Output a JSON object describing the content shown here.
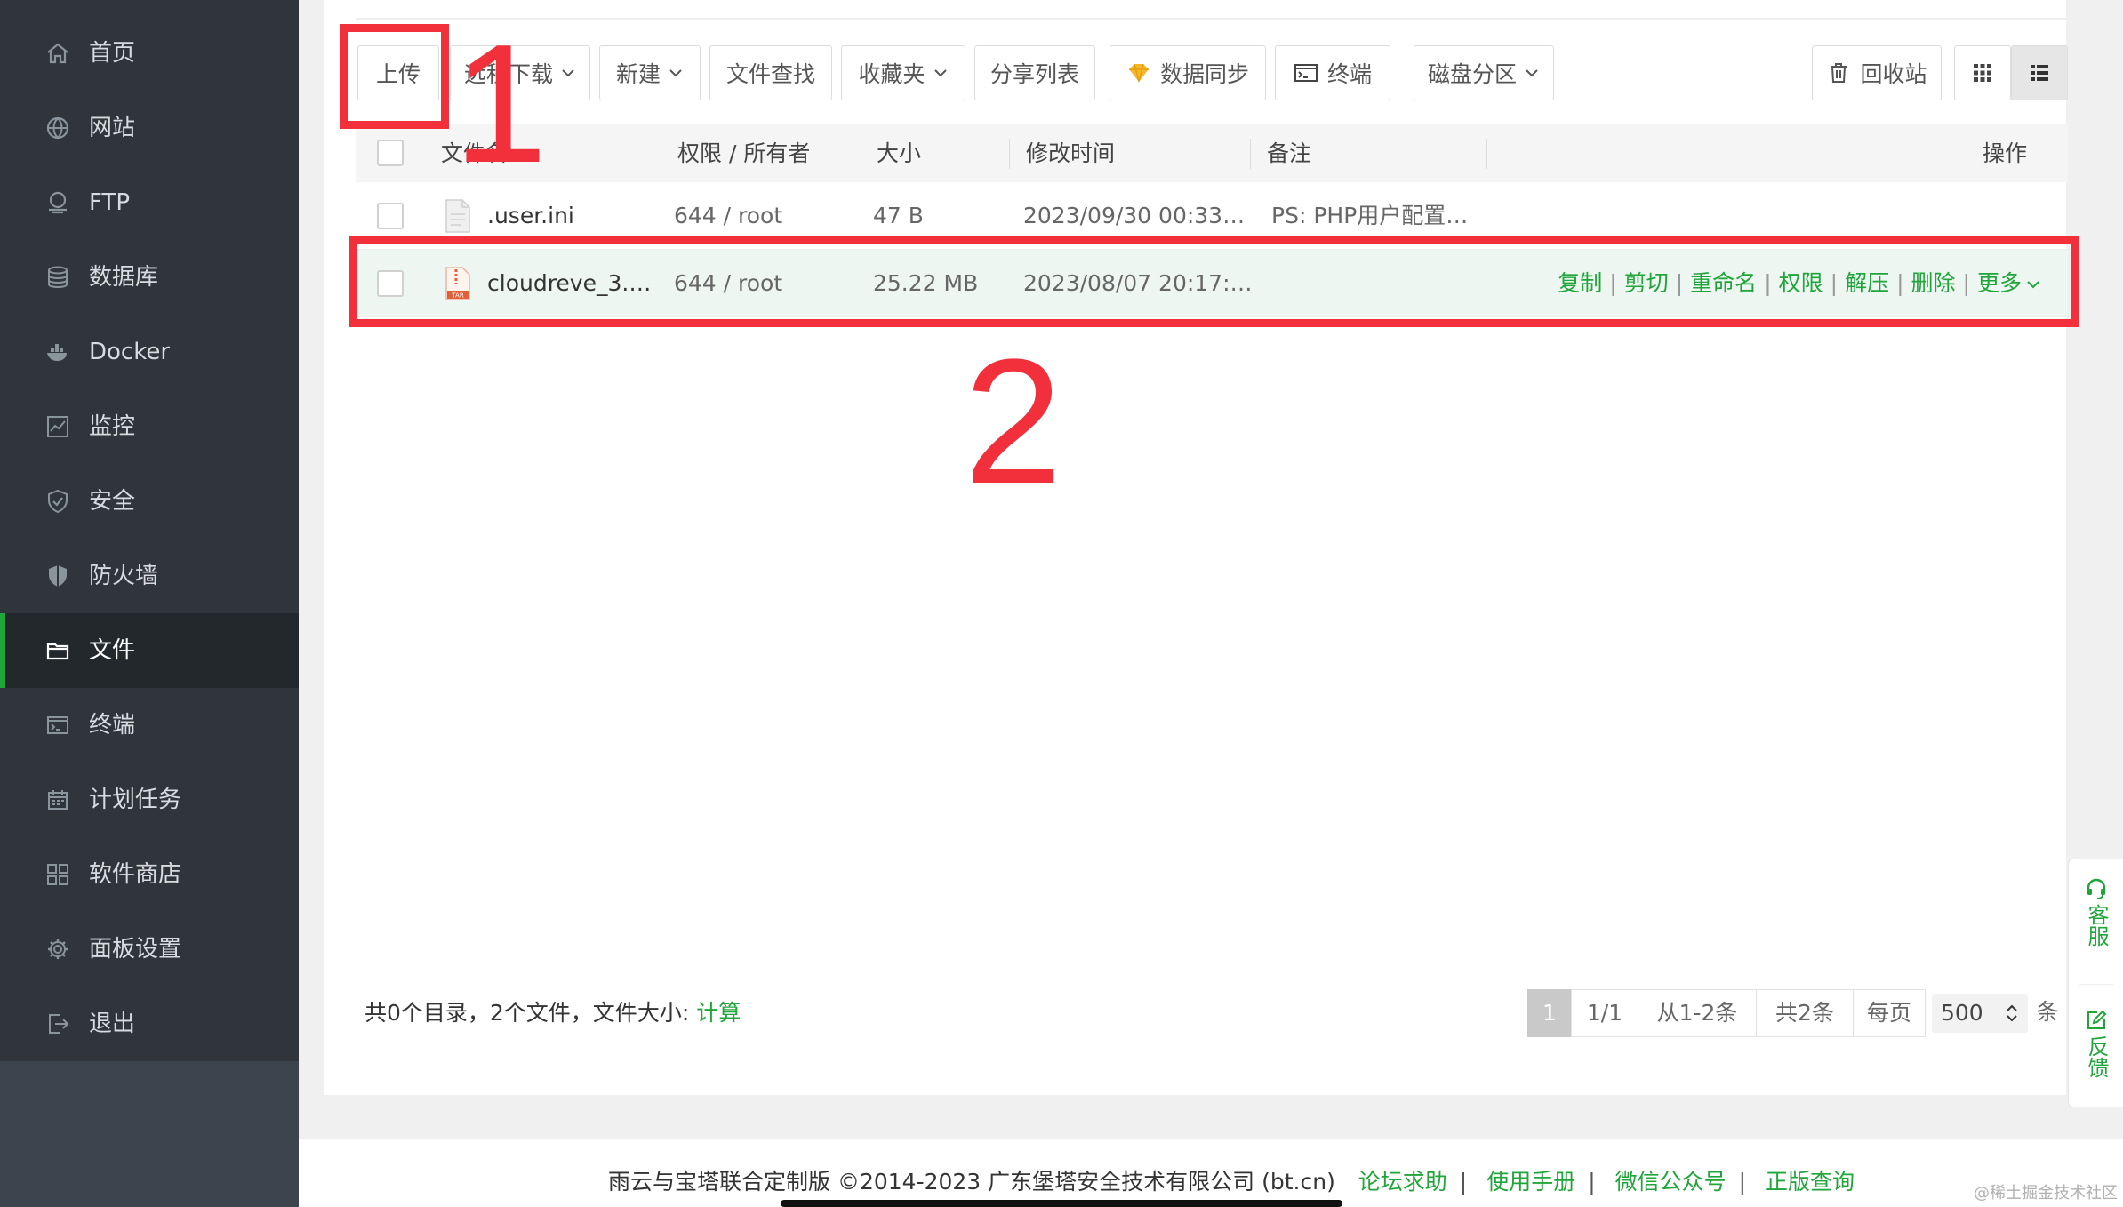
{
  "sidebar": {
    "items": [
      {
        "label": "首页",
        "icon": "home-icon"
      },
      {
        "label": "网站",
        "icon": "globe-icon"
      },
      {
        "label": "FTP",
        "icon": "ftp-icon"
      },
      {
        "label": "数据库",
        "icon": "database-icon"
      },
      {
        "label": "Docker",
        "icon": "docker-icon"
      },
      {
        "label": "监控",
        "icon": "monitor-icon"
      },
      {
        "label": "安全",
        "icon": "shield-check-icon"
      },
      {
        "label": "防火墙",
        "icon": "firewall-icon"
      },
      {
        "label": "文件",
        "icon": "folder-icon",
        "active": true
      },
      {
        "label": "终端",
        "icon": "terminal-icon"
      },
      {
        "label": "计划任务",
        "icon": "calendar-icon"
      },
      {
        "label": "软件商店",
        "icon": "apps-icon"
      },
      {
        "label": "面板设置",
        "icon": "gear-icon"
      },
      {
        "label": "退出",
        "icon": "logout-icon"
      }
    ]
  },
  "toolbar": {
    "upload": "上传",
    "remote_download": "远程下载",
    "new": "新建",
    "file_search": "文件查找",
    "favorites": "收藏夹",
    "share_list": "分享列表",
    "data_sync": "数据同步",
    "terminal": "终端",
    "disk_partition": "磁盘分区",
    "recycle_bin": "回收站"
  },
  "table": {
    "headers": {
      "name": "文件名",
      "perm_owner": "权限 / 所有者",
      "size": "大小",
      "mtime": "修改时间",
      "remark": "备注",
      "ops": "操作"
    },
    "rows": [
      {
        "name": ".user.ini",
        "perm_owner": "644 / root",
        "size": "47 B",
        "mtime": "2023/09/30 00:33…",
        "remark": "PS: PHP用户配置…"
      },
      {
        "name": "cloudreve_3.…",
        "perm_owner": "644 / root",
        "size": "25.22 MB",
        "mtime": "2023/08/07 20:17:…",
        "remark": "",
        "file_badge": "TAR",
        "ops": [
          "复制",
          "剪切",
          "重命名",
          "权限",
          "解压",
          "删除",
          "更多"
        ]
      }
    ]
  },
  "summary": {
    "text": "共0个目录，2个文件，文件大小:",
    "calc": "计算"
  },
  "pagination": {
    "current": "1",
    "pages": "1/1",
    "range": "从1-2条",
    "total": "共2条",
    "per_page_label": "每页",
    "per_page_value": "500",
    "unit": "条"
  },
  "annotations": {
    "one": "1",
    "two": "2"
  },
  "float": {
    "service": "客服",
    "feedback": "反馈"
  },
  "footer": {
    "copyright": "雨云与宝塔联合定制版 ©2014-2023 广东堡塔安全技术有限公司 (bt.cn)",
    "links": [
      "论坛求助",
      "使用手册",
      "微信公众号",
      "正版查询"
    ]
  },
  "watermark": "@稀土掘金技术社区",
  "colors": {
    "accent": "#20a53a",
    "sidebar": "#2f353b",
    "annotation": "#f2303c"
  }
}
